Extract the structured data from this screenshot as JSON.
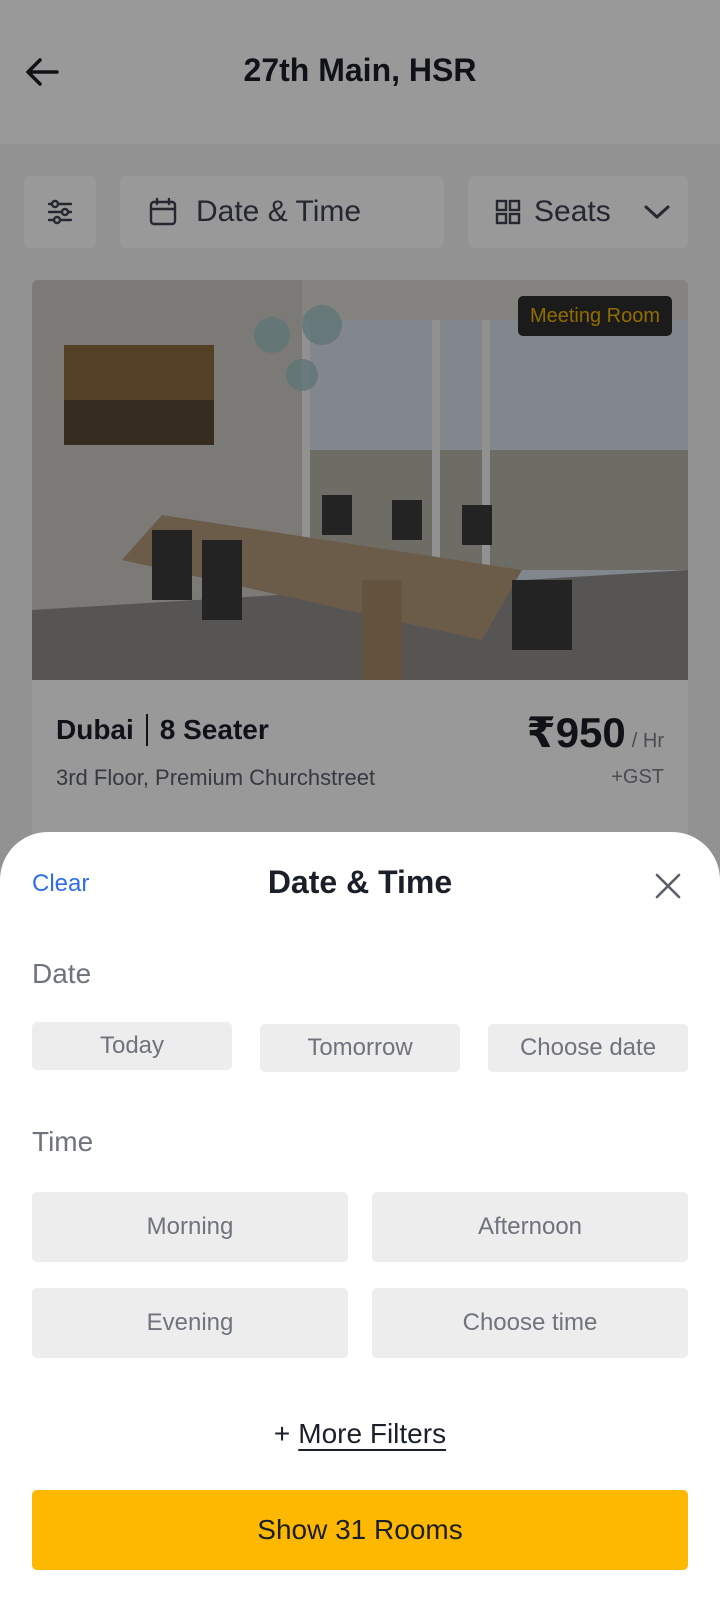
{
  "header": {
    "title": "27th Main, HSR",
    "back_icon": "arrow-left-icon"
  },
  "filters": {
    "filter_icon": "sliders-icon",
    "date_time_label": "Date & Time",
    "date_icon": "calendar-icon",
    "seats_label": "Seats",
    "seats_icon": "grid-icon",
    "seats_chevron": "chevron-down-icon"
  },
  "room": {
    "badge": "Meeting Room",
    "city": "Dubai",
    "capacity": "8 Seater",
    "address": "3rd Floor, Premium Churchstreet",
    "price": "₹950",
    "price_unit": "/ Hr",
    "tax": "+GST"
  },
  "sheet": {
    "clear_label": "Clear",
    "title": "Date & Time",
    "close_icon": "close-icon",
    "date_label": "Date",
    "date_options": [
      "Today",
      "Tomorrow",
      "Choose date"
    ],
    "time_label": "Time",
    "time_options": [
      "Morning",
      "Afternoon",
      "Evening",
      "Choose time"
    ],
    "more_filters_prefix": "+",
    "more_filters_label": "More Filters",
    "cta_label": "Show 31 Rooms"
  },
  "colors": {
    "accent": "#ffb800",
    "link": "#2f6ee7",
    "badge_text": "#f4b400"
  }
}
